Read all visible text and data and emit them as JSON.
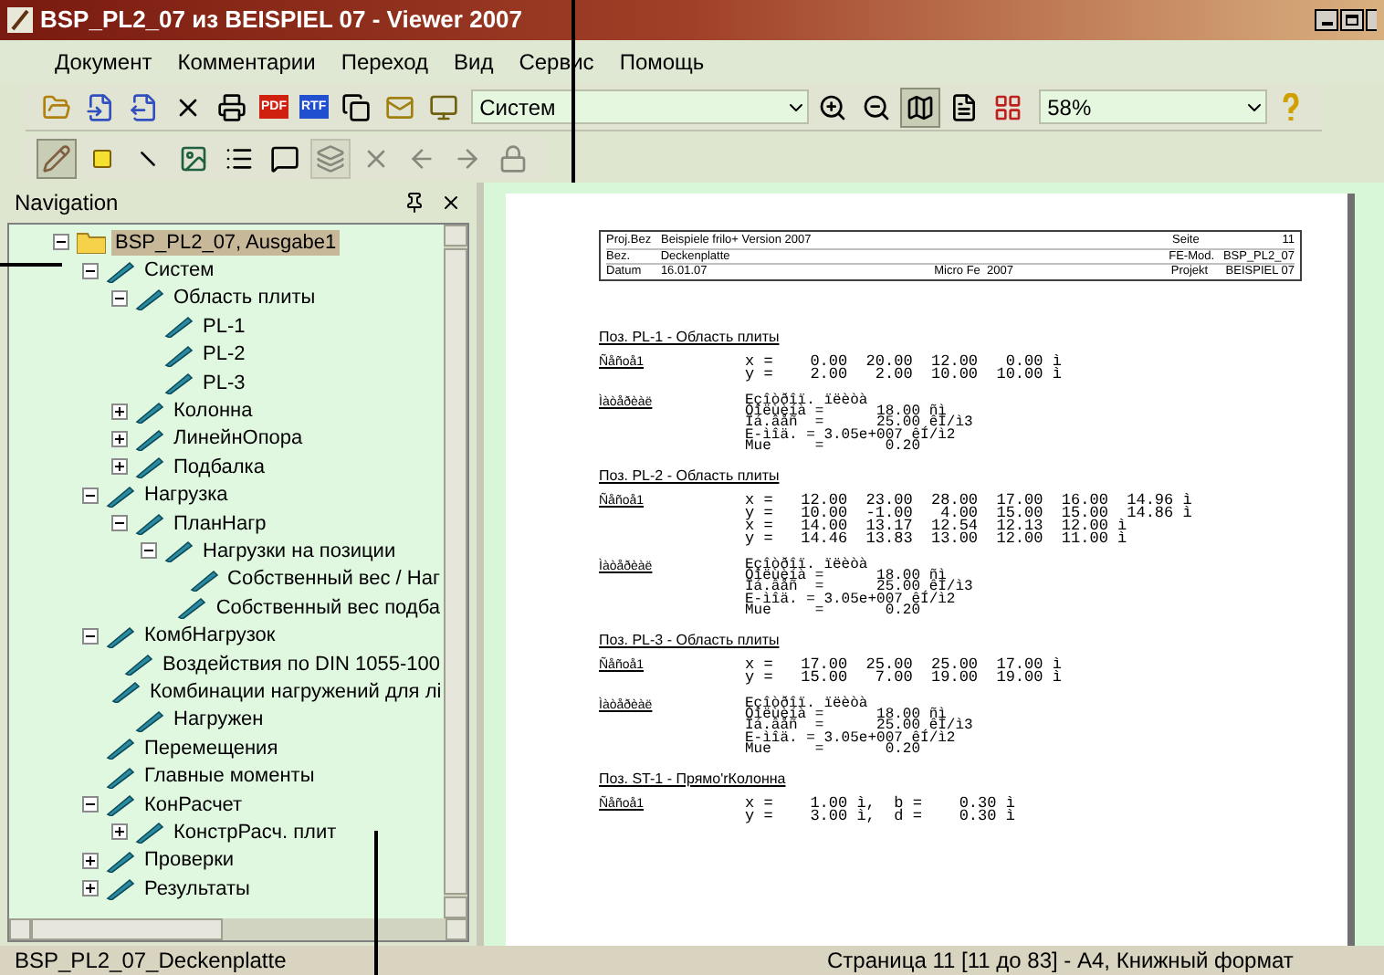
{
  "window": {
    "title": "BSP_PL2_07 из BEISPIEL 07 - Viewer 2007"
  },
  "menu": [
    {
      "label": "Документ"
    },
    {
      "label": "Комментарии"
    },
    {
      "label": "Переход"
    },
    {
      "label": "Вид"
    },
    {
      "label": "Сервис"
    },
    {
      "label": "Помощь"
    }
  ],
  "toolbar_1": {
    "pdf_label": "PDF",
    "rtf_label": "RTF",
    "view_combo": {
      "value": "Систем"
    },
    "zoom_combo": {
      "value": "58%"
    },
    "view_buttons": [
      {
        "selected": true
      },
      {
        "selected": false
      },
      {
        "selected": false
      }
    ]
  },
  "toolbar_2": {
    "buttons": [
      {
        "pressed": true,
        "disabled": false
      },
      {
        "pressed": false,
        "disabled": false
      },
      {
        "pressed": false,
        "disabled": false
      },
      {
        "pressed": false,
        "disabled": false
      },
      {
        "pressed": false,
        "disabled": false
      },
      {
        "pressed": false,
        "disabled": false
      },
      {
        "pressed": true,
        "disabled": true
      },
      {
        "pressed": false,
        "disabled": true
      },
      {
        "pressed": false,
        "disabled": true
      },
      {
        "pressed": false,
        "disabled": true
      },
      {
        "pressed": false,
        "disabled": true
      }
    ]
  },
  "navigation": {
    "title": "Navigation",
    "tree": [
      {
        "label": "BSP_PL2_07, Ausgabe1",
        "kind": "folder",
        "selected": true,
        "expanded": true,
        "children": [
          {
            "label": "Систем",
            "kind": "item",
            "selected": false,
            "expanded": true,
            "children": [
              {
                "label": "Область плиты",
                "kind": "item",
                "selected": false,
                "expanded": true,
                "children": [
                  {
                    "label": "PL-1",
                    "kind": "item",
                    "selected": false
                  },
                  {
                    "label": "PL-2",
                    "kind": "item",
                    "selected": false
                  },
                  {
                    "label": "PL-3",
                    "kind": "item",
                    "selected": false
                  }
                ]
              },
              {
                "label": "Колонна",
                "kind": "item",
                "selected": false,
                "expanded": false
              },
              {
                "label": "ЛинейнОпора",
                "kind": "item",
                "selected": false,
                "expanded": false
              },
              {
                "label": "Подбалка",
                "kind": "item",
                "selected": false,
                "expanded": false
              }
            ]
          },
          {
            "label": "Нагрузка",
            "kind": "item",
            "selected": false,
            "expanded": true,
            "children": [
              {
                "label": "ПланНагр",
                "kind": "item",
                "selected": false,
                "expanded": true,
                "children": [
                  {
                    "label": "Нагрузки на позиции",
                    "kind": "item",
                    "selected": false,
                    "expanded": true,
                    "children": [
                      {
                        "label": "Собственный вес / Наг",
                        "kind": "item",
                        "selected": false
                      },
                      {
                        "label": "Собственный вес подба",
                        "kind": "item",
                        "selected": false
                      }
                    ]
                  }
                ]
              }
            ]
          },
          {
            "label": "КомбНагрузок",
            "kind": "item",
            "selected": false,
            "expanded": true,
            "children": [
              {
                "label": "Воздействия по DIN 1055-100",
                "kind": "item",
                "selected": false
              },
              {
                "label": "Комбинации нагружений для лі",
                "kind": "item",
                "selected": false
              },
              {
                "label": "Нагружен",
                "kind": "item",
                "selected": false
              }
            ]
          },
          {
            "label": "Перемещения",
            "kind": "item",
            "selected": false
          },
          {
            "label": "Главные моменты",
            "kind": "item",
            "selected": false
          },
          {
            "label": "КонРасчет",
            "kind": "item",
            "selected": false,
            "expanded": true,
            "children": [
              {
                "label": "КонстрРасч. плит",
                "kind": "item",
                "selected": false,
                "expanded": false
              }
            ]
          },
          {
            "label": "Проверки",
            "kind": "item",
            "selected": false,
            "expanded": false
          },
          {
            "label": "Результаты",
            "kind": "item",
            "selected": false,
            "expanded": false
          }
        ]
      }
    ]
  },
  "document": {
    "header": [
      {
        "label": "Proj.Bez",
        "value": "Beispiele frilo+ Version 2007",
        "right_label": "Seite",
        "right_value": "11"
      },
      {
        "label": "Bez.",
        "value": "Deckenplatte",
        "right_label": "FE-Mod.",
        "right_value": "BSP_PL2_07"
      },
      {
        "label": "Datum",
        "value": "16.01.07",
        "middle": "Micro Fe  2007",
        "right_label": "Projekt",
        "right_value": "BEISPIEL 07"
      }
    ],
    "sections": [
      {
        "title": "Поз. PL-1 - Область плиты",
        "geometry_label": "Ñåñoå1",
        "coordinates": [
          "x =    0.00  20.00  12.00   0.00 ì",
          "y =    2.00   2.00  10.00  10.00 ì"
        ],
        "material_label": "Ìàòåðèàë",
        "material": [
          "Eçîòðîï. ïëèòà",
          "Òîëùèíà =      18.00 ñì",
          "Îá.âåñ  =      25.00 êÍ/ì3",
          "E-ìîä. = 3.05e+007 êÍ/ì2",
          "Mue     =       0.20"
        ]
      },
      {
        "title": "Поз. PL-2 - Область плиты",
        "geometry_label": "Ñåñoå1",
        "coordinates": [
          "x =   12.00  23.00  28.00  17.00  16.00  14.96 ì",
          "y =   10.00  -1.00   4.00  15.00  15.00  14.86 ì",
          "x =   14.00  13.17  12.54  12.13  12.00 ì",
          "y =   14.46  13.83  13.00  12.00  11.00 ì"
        ],
        "material_label": "Ìàòåðèàë",
        "material": [
          "Eçîòðîï. ïëèòà",
          "Òîëùèíà =      18.00 ñì",
          "Îá.âåñ  =      25.00 êÍ/ì3",
          "E-ìîä. = 3.05e+007 êÍ/ì2",
          "Mue     =       0.20"
        ]
      },
      {
        "title": "Поз. PL-3 - Область плиты",
        "geometry_label": "Ñåñoå1",
        "coordinates": [
          "x =   17.00  25.00  25.00  17.00 ì",
          "y =   15.00   7.00  19.00  19.00 ì"
        ],
        "material_label": "Ìàòåðèàë",
        "material": [
          "Eçîòðîï. ïëèòà",
          "Òîëùèíà =      18.00 ñì",
          "Îá.âåñ  =      25.00 êÍ/ì3",
          "E-ìîä. = 3.05e+007 êÍ/ì2",
          "Mue     =       0.20"
        ]
      },
      {
        "title": "Поз. ST-1 - Прямо'rКолонна",
        "geometry_label": "Ñåñoå1",
        "coordinates": [
          "x =    1.00 ì,  b =    0.30 ì",
          "y =    3.00 ì,  d =    0.30 ì"
        ]
      }
    ]
  },
  "status_bar": {
    "left": "BSP_PL2_07_Deckenplatte",
    "right": "Страница 11 [11 до 83] - A4, Книжный формат"
  }
}
